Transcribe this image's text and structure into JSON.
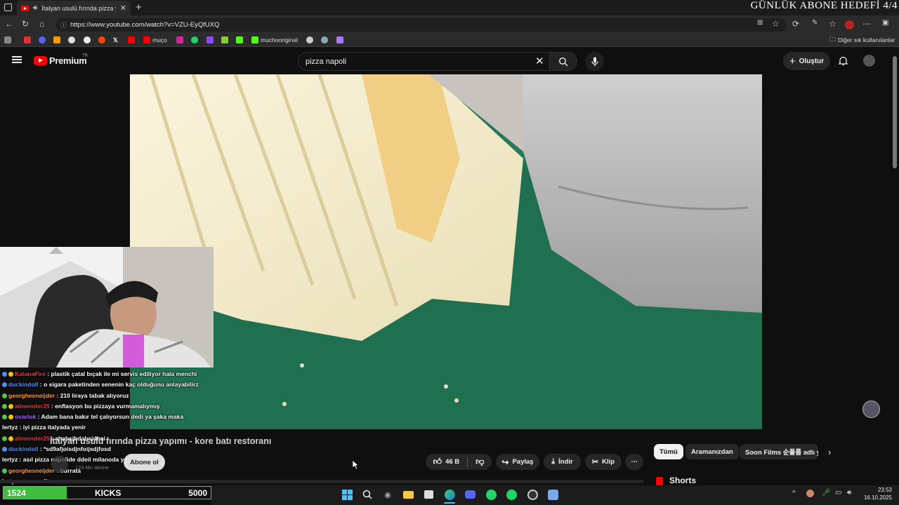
{
  "browser": {
    "tab_title": "İtalyan usulü fırında pizza yap",
    "url": "https://www.youtube.com/watch?v=VZU-EyQfUXQ",
    "bookmarks": [
      "muço",
      "muchooriginal"
    ],
    "other_bookmarks": "Diğer sık kullanılanlar"
  },
  "overlay": {
    "goal_text": "GÜNLÜK ABONE HEDEFİ 4/4",
    "kicks": {
      "current": "1524",
      "label": "KICKS",
      "target": "5000",
      "progress": 0.3048
    }
  },
  "youtube": {
    "logo_text": "Premium",
    "region": "TR",
    "search_value": "pizza napoli",
    "create_label": "Oluştur",
    "video_title": "İtalyan usulü fırında pizza yapımı - kore batı restoranı",
    "channel_subs": "124 Mn abone",
    "subscribe_label": "Abone ol",
    "likes": "46 B",
    "share_label": "Paylaş",
    "download_label": "İndir",
    "clip_label": "Klip",
    "chips": [
      "Tümü",
      "Aramanızdan",
      "Soon Films 순풀름 adlı y"
    ],
    "shorts_label": "Shorts"
  },
  "chat": [
    {
      "user": "KatanaFire",
      "color": "#e23b3b",
      "msg": "plastik çatal bıçak ile mi servis ediliyor hala menchi"
    },
    {
      "user": "duckindoll",
      "color": "#4c8dff",
      "msg": "o sigara paketinden senenin kaç olduğunu anlayabilirz"
    },
    {
      "user": "georghesneijder",
      "color": "#ff9d2e",
      "msg": "210 liraya tabak alıyoruz"
    },
    {
      "user": "alimender25",
      "color": "#e23b3b",
      "msg": "enflasyon bu pizzaya vurmamalıymış"
    },
    {
      "user": "ovarlok",
      "color": "#b05cff",
      "msg": "Adam bana bakır tel çalıyorsun dedi ya şaka maka"
    },
    {
      "user": "lertyz",
      "color": "#ffffff",
      "msg": "iyi pizza italyada yenir"
    },
    {
      "user": "alimender25",
      "color": "#e23b3b",
      "msg": "ahabsjhdabsjdhai"
    },
    {
      "user": "duckindoll",
      "color": "#4c8dff",
      "msg": "*sd9afjoisdjnfoijsdjfosd"
    },
    {
      "user": "lertyz",
      "color": "#ffffff",
      "msg": "asıl pizza napolide ddeil milanoda yenir"
    },
    {
      "user": "georghesneijder",
      "color": "#ff9d2e",
      "msg": "burrata"
    },
    {
      "user": "lertyz",
      "color": "#ffffff",
      "msg": "mozarella"
    }
  ],
  "clock": {
    "time": "23:53",
    "date": "16.10.2025"
  },
  "colors": {
    "accent": "#ff0000",
    "kicks_fill": "#3fbd3f",
    "cutting_board": "#1f7050"
  }
}
